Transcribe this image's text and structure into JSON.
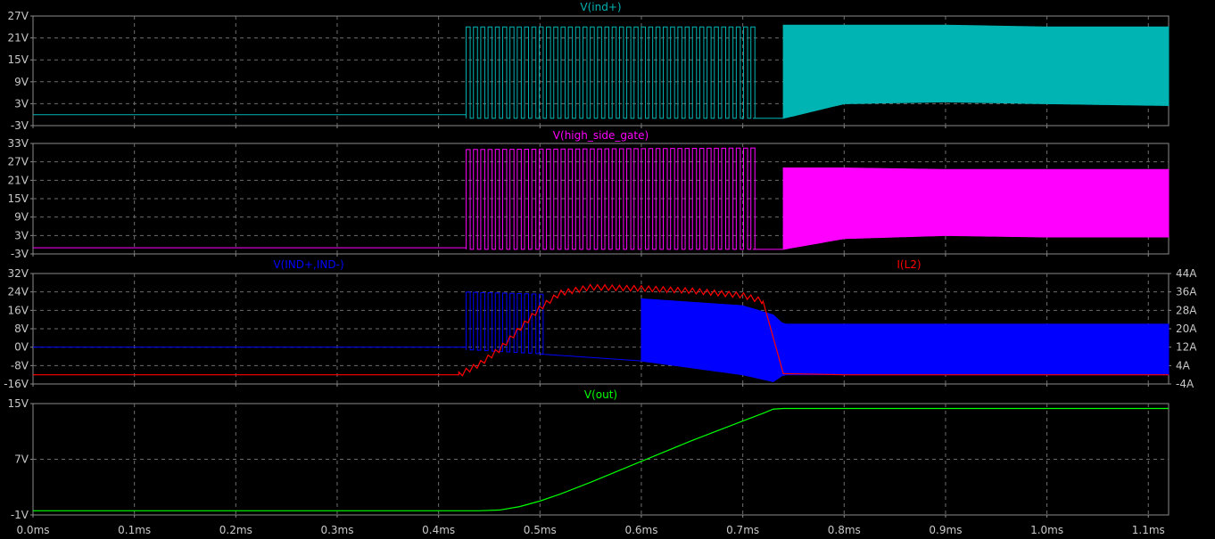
{
  "chart_data": [
    {
      "type": "line",
      "title": "V(ind+)",
      "ylim": [
        -3,
        27
      ],
      "yticks": [
        "27V",
        "21V",
        "15V",
        "9V",
        "3V",
        "-3V"
      ],
      "series": [
        {
          "name": "V(ind+)",
          "color": "#00b4b4",
          "x_ms": [
            0.0,
            0.42,
            0.42,
            0.71,
            0.74,
            0.8,
            0.9,
            1.0,
            1.12
          ],
          "y_low": [
            0.0,
            0.0,
            -1.0,
            -1.0,
            -1.0,
            3.0,
            3.5,
            3.0,
            2.5
          ],
          "y_high": [
            0.0,
            0.0,
            24.0,
            24.0,
            24.5,
            24.5,
            24.5,
            24.0,
            24.0
          ],
          "notes": "0-0.42ms flat ~0V; 0.42-0.71ms discrete pulses -1V..24V; 0.74-1.12ms dense switching band"
        }
      ]
    },
    {
      "type": "line",
      "title": "V(high_side_gate)",
      "ylim": [
        -3,
        33
      ],
      "yticks": [
        "33V",
        "27V",
        "21V",
        "15V",
        "9V",
        "3V",
        "-3V"
      ],
      "series": [
        {
          "name": "V(high_side_gate)",
          "color": "#ff00ff",
          "x_ms": [
            0.0,
            0.42,
            0.42,
            0.71,
            0.74,
            0.8,
            0.9,
            1.0,
            1.12
          ],
          "y_low": [
            -1.0,
            -1.0,
            -1.5,
            -1.5,
            -1.5,
            2.0,
            3.0,
            2.5,
            2.5
          ],
          "y_high": [
            -1.0,
            -1.0,
            31.0,
            31.5,
            25.0,
            25.0,
            24.5,
            24.5,
            24.5
          ]
        }
      ]
    },
    {
      "type": "line",
      "title_left": "V(IND+,IND-)",
      "title_right": "I(L2)",
      "ylim": [
        -16,
        32
      ],
      "ylim_right": [
        -4,
        44
      ],
      "yticks": [
        "32V",
        "24V",
        "16V",
        "8V",
        "0V",
        "-8V",
        "-16V"
      ],
      "yticks_right": [
        "44A",
        "36A",
        "28A",
        "20A",
        "12A",
        "4A",
        "-4A"
      ],
      "series": [
        {
          "name": "V(IND+,IND-)",
          "color": "#0000ff",
          "x_ms": [
            0.0,
            0.42,
            0.42,
            0.5,
            0.6,
            0.7,
            0.73,
            0.74,
            0.9,
            1.12
          ],
          "y_low": [
            0.0,
            0.0,
            -1.0,
            -3.0,
            -6.0,
            -12.0,
            -15.0,
            -12.0,
            -12.0,
            -12.0
          ],
          "y_high": [
            0.0,
            0.0,
            24.0,
            23.0,
            21.0,
            18.0,
            14.0,
            10.0,
            10.0,
            10.0
          ]
        },
        {
          "name": "I(L2)",
          "color": "#ff0000",
          "x": [
            0.0,
            0.42,
            0.44,
            0.46,
            0.48,
            0.5,
            0.52,
            0.55,
            0.6,
            0.65,
            0.7,
            0.72,
            0.74,
            0.8,
            0.9,
            1.0,
            1.12
          ],
          "y": [
            0.0,
            0.0,
            4.5,
            11.0,
            20.0,
            29.0,
            35.5,
            38.0,
            37.5,
            36.5,
            34.5,
            32.0,
            0.5,
            0.0,
            0.0,
            0.0,
            0.0
          ]
        }
      ]
    },
    {
      "type": "line",
      "title": "V(out)",
      "ylim": [
        -1,
        15
      ],
      "yticks": [
        "15V",
        "7V",
        "-1V"
      ],
      "xlim": [
        0.0,
        1.12
      ],
      "xticks": [
        "0.0ms",
        "0.1ms",
        "0.2ms",
        "0.3ms",
        "0.4ms",
        "0.5ms",
        "0.6ms",
        "0.7ms",
        "0.8ms",
        "0.9ms",
        "1.0ms",
        "1.1ms"
      ],
      "series": [
        {
          "name": "V(out)",
          "color": "#00ff00",
          "x": [
            0.0,
            0.44,
            0.46,
            0.48,
            0.5,
            0.52,
            0.55,
            0.6,
            0.65,
            0.7,
            0.72,
            0.73,
            0.74,
            1.12
          ],
          "y": [
            -0.4,
            -0.4,
            -0.3,
            0.2,
            1.0,
            2.0,
            3.7,
            6.7,
            9.7,
            12.5,
            13.6,
            14.2,
            14.3,
            14.3
          ]
        }
      ]
    }
  ]
}
